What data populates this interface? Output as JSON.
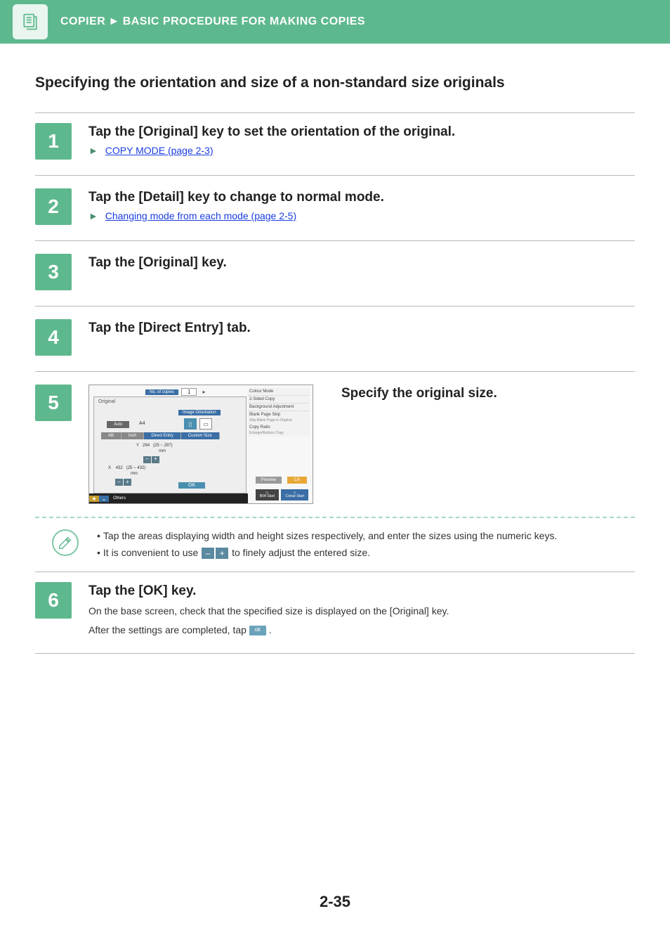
{
  "header": {
    "breadcrumb_1": "COPIER",
    "breadcrumb_sep": "►",
    "breadcrumb_2": "BASIC PROCEDURE FOR MAKING COPIES"
  },
  "section_title": "Specifying the orientation and size of a non-standard size originals",
  "steps": {
    "s1": {
      "num": "1",
      "title": "Tap the [Original] key to set the orientation of the original.",
      "link": "COPY MODE (page 2-3)"
    },
    "s2": {
      "num": "2",
      "title": "Tap the [Detail] key to change to normal mode.",
      "link": "Changing mode from each mode (page 2-5)"
    },
    "s3": {
      "num": "3",
      "title": "Tap the [Original] key."
    },
    "s4": {
      "num": "4",
      "title": "Tap the [Direct Entry] tab."
    },
    "s5": {
      "num": "5",
      "title": "Specify the original size."
    },
    "s6": {
      "num": "6",
      "title": "Tap the [OK] key.",
      "body1": "On the base screen, check that the specified size is displayed on the [Original] key.",
      "body2a": "After the settings are completed, tap ",
      "body2b": " .",
      "ok_label": "ok"
    }
  },
  "tips": {
    "t1": "Tap the areas displaying width and height sizes respectively, and enter the sizes using the numeric keys.",
    "t2a": "It is convenient to use ",
    "t2b": " to finely adjust the entered size.",
    "minus": "–",
    "plus": "+"
  },
  "ui": {
    "no_of_copies": "No. of copies",
    "copies_val": "1",
    "ok": "OK",
    "original": "Original",
    "image_orientation": "Image Orientation",
    "auto": "Auto",
    "a4": "A4",
    "tab_ab": "AB",
    "tab_inch": "Inch",
    "tab_direct": "Direct Entry",
    "tab_custom": "Custom Size",
    "y_label": "Y",
    "y_val": "294",
    "y_range": "(25 ~ 297)",
    "x_label": "X",
    "x_val": "432",
    "x_range": "(25 ~ 432)",
    "mm": "mm",
    "side": {
      "colour_mode": "Colour Mode",
      "two_sided": "2-Sided Copy",
      "bg": "Background Adjustment",
      "blank": "Blank Page Skip",
      "blank_sub": "Skip Blank Page in Original",
      "ratio": "Copy Ratio",
      "ratio_sub": "Enlarge/Reduce Copy"
    },
    "preview": "Preview",
    "ca": "CA",
    "bw_start": "B/W Start",
    "colour_start": "Colour Start",
    "others": "Others"
  },
  "page_number": "2-35"
}
